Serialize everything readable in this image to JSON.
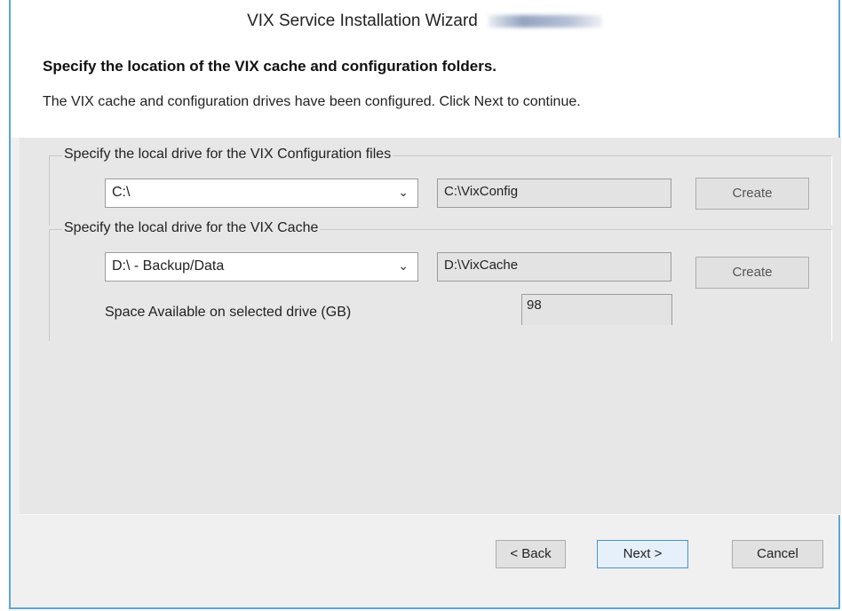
{
  "window": {
    "title": "VIX Service Installation Wizard"
  },
  "header": {
    "heading": "Specify the location of the VIX cache and configuration folders.",
    "subtext": "The VIX cache and configuration drives have been configured. Click Next to continue."
  },
  "config_group": {
    "label": "Specify the local drive for the VIX Configuration files",
    "drive_selected": "C:\\",
    "path": "C:\\VixConfig",
    "create_label": "Create"
  },
  "cache_group": {
    "label": "Specify the local drive for the VIX Cache",
    "drive_selected": "D:\\ - Backup/Data",
    "path": "D:\\VixCache",
    "create_label": "Create",
    "space_label": "Space Available on selected drive (GB)",
    "space_value": "98"
  },
  "footer": {
    "back_label": "< Back",
    "next_label": "Next >",
    "cancel_label": "Cancel"
  },
  "icons": {
    "dropdown": "chevron-down-icon"
  },
  "colors": {
    "window_border": "#5aa6d8",
    "next_button_border": "#4a90d0"
  }
}
